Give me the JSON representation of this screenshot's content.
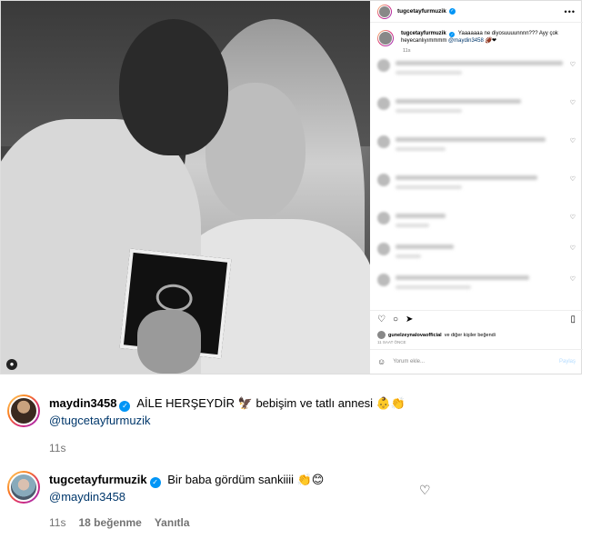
{
  "post": {
    "username": "tugcetayfurmuzik",
    "caption_text": "Yaaaaaaa ne diyosuuuunnnn??? Ayy çok heyecanlıyımmmm",
    "caption_mention": "@maydin3458",
    "caption_emoji": "🏈❤",
    "caption_time": "11s",
    "liked_by_user": "gunelzeynalovaofficial",
    "liked_by_suffix": "ve diğer kişiler beğendi",
    "date": "11 SAAT ÖNCE",
    "comment_placeholder": "Yorum ekle...",
    "share_label": "Paylaş"
  },
  "comments": [
    {
      "username": "maydin3458",
      "text": "AİLE HERŞEYDİR",
      "text2": "bebişim ve tatlı annesi",
      "emoji1": "🦅",
      "emoji2": "👶👏",
      "mention": "@tugcetayfurmuzik",
      "time": "11s"
    },
    {
      "username": "tugcetayfurmuzik",
      "text": "Bir baba gördüm sankiiii",
      "emoji": "👏😊",
      "mention": "@maydin3458",
      "time": "11s",
      "likes": "18 beğenme",
      "reply": "Yanıtla"
    }
  ],
  "icons": {
    "heart": "♡",
    "comment": "○",
    "share": "➤",
    "bookmark": "▯",
    "more": "•••",
    "emoji": "☺"
  },
  "colors": {
    "verified": "#0095f6",
    "mention": "#00376b",
    "meta": "#737373"
  }
}
